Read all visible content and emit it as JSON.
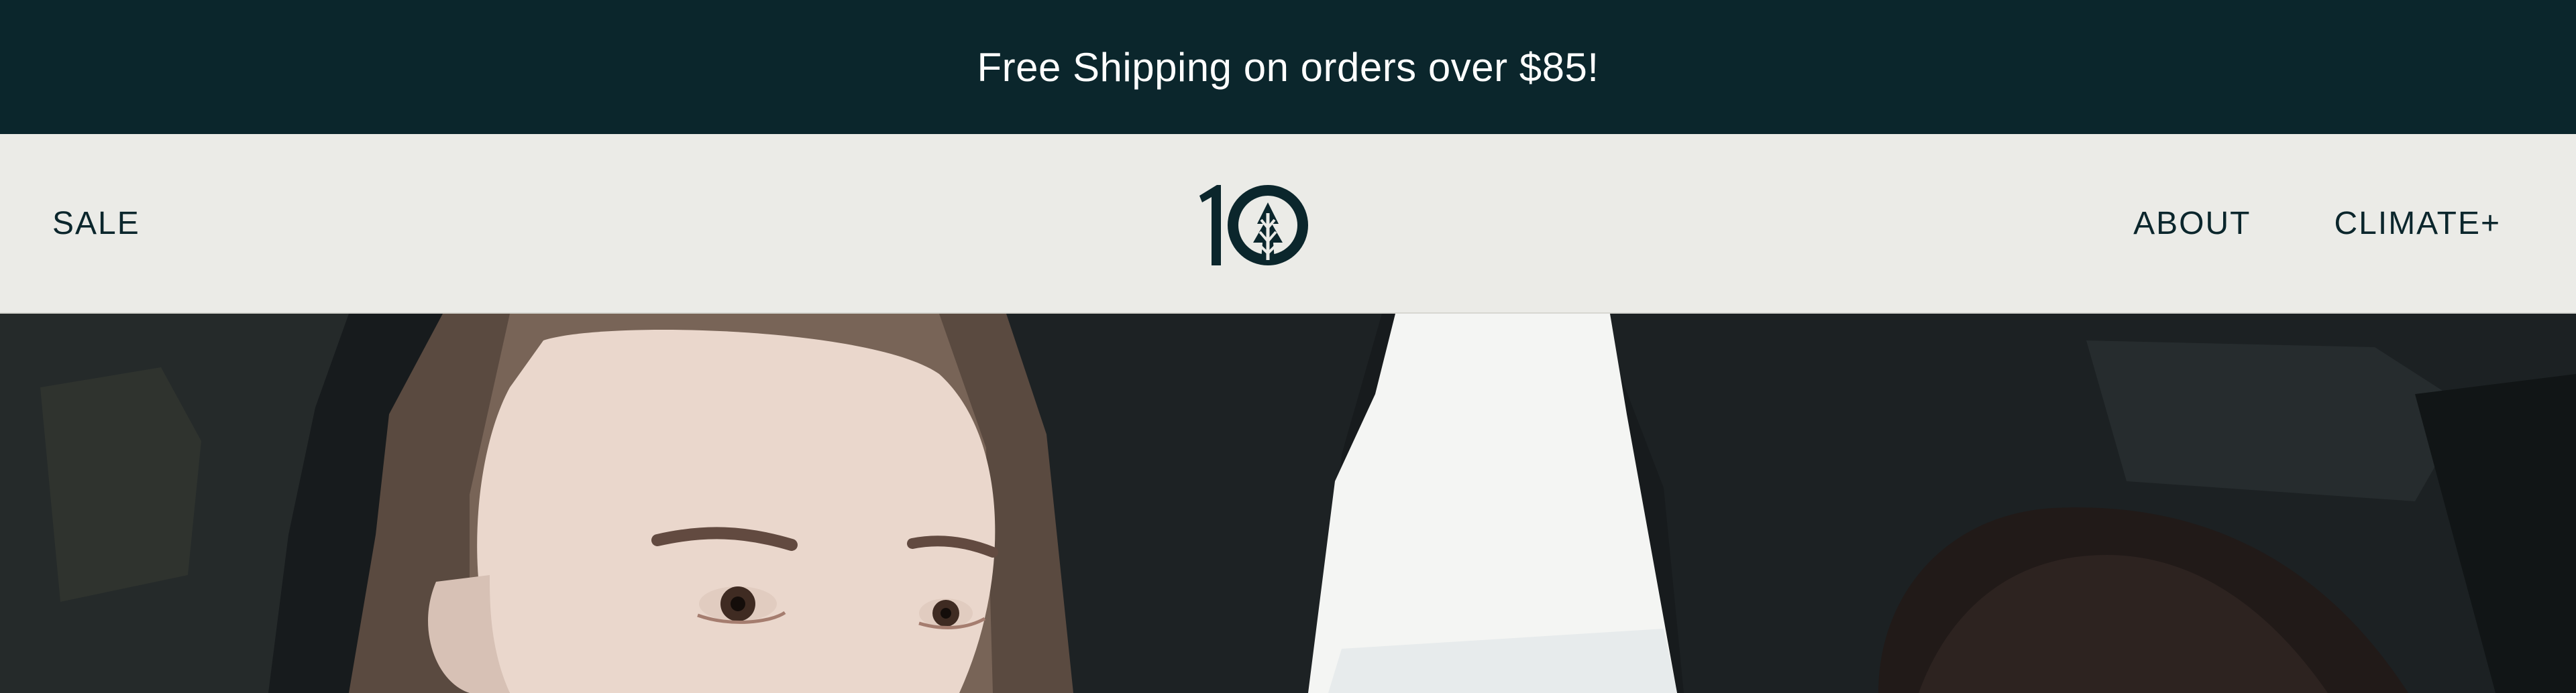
{
  "announcement": {
    "text": "Free Shipping on orders over $85!"
  },
  "nav": {
    "left": [
      {
        "label": "SALE"
      }
    ],
    "right": [
      {
        "label": "ABOUT"
      },
      {
        "label": "CLIMATE+"
      }
    ]
  },
  "logo": {
    "text": "10",
    "icon": "tree-in-circle-icon"
  },
  "hero": {
    "image": "two-people-in-rocky-sea-cave-photo"
  },
  "colors": {
    "announcement_bg": "#0b262c",
    "header_bg": "#ebebe7",
    "brand_dark": "#0b262c",
    "announcement_text": "#ffffff"
  }
}
